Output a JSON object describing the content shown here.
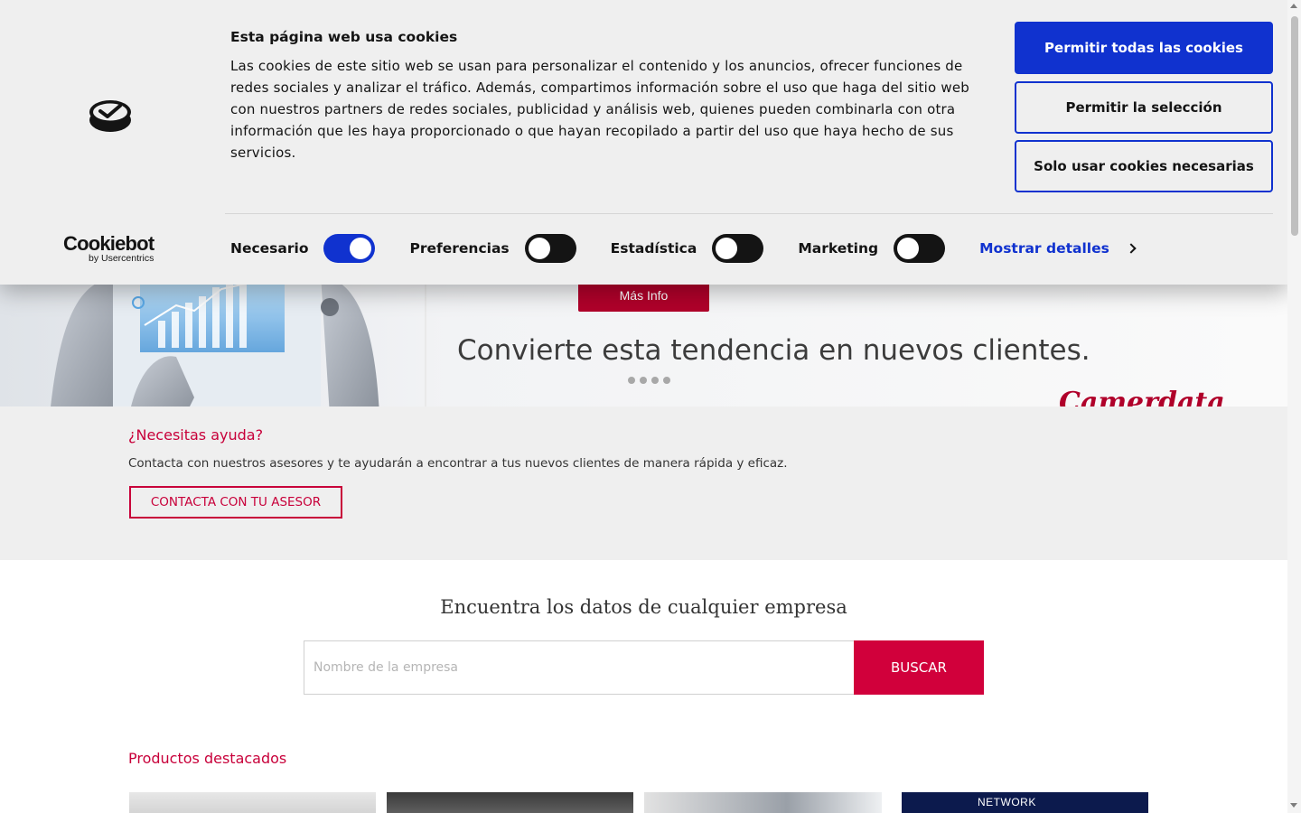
{
  "cookie_banner": {
    "title": "Esta página web usa cookies",
    "text": "Las cookies de este sitio web se usan para personalizar el contenido y los anuncios, ofrecer funciones de redes sociales y analizar el tráfico. Además, compartimos información sobre el uso que haga del sitio web con nuestros partners de redes sociales, publicidad y análisis web, quienes pueden combinarla con otra información que les haya proporcionado o que hayan recopilado a partir del uso que haya hecho de sus servicios.",
    "buttons": {
      "allow_all": "Permitir todas las cookies",
      "allow_selection": "Permitir la selección",
      "necessary_only": "Solo usar cookies necesarias"
    },
    "brand": {
      "name": "Cookiebot",
      "sub": "by Usercentrics"
    },
    "toggles": [
      {
        "label": "Necesario",
        "on": true
      },
      {
        "label": "Preferencias",
        "on": false
      },
      {
        "label": "Estadística",
        "on": false
      },
      {
        "label": "Marketing",
        "on": false
      }
    ],
    "details_link": "Mostrar detalles",
    "accent_color": "#1032cf",
    "icons": [
      "cookiebot-logo-icon",
      "chevron-right-icon"
    ]
  },
  "hero": {
    "button": "Más Info",
    "headline": "Convierte esta tendencia en nuevos clientes.",
    "brand_peek": "Camerdata",
    "slide_count": 4
  },
  "help": {
    "title": "¿Necesitas ayuda?",
    "text": "Contacta con nuestros asesores y te ayudarán a encontrar a tus nuevos clientes de manera rápida y eficaz.",
    "button": "CONTACTA CON TU ASESOR"
  },
  "search": {
    "title": "Encuentra los datos de cualquier empresa",
    "placeholder": "Nombre de la empresa",
    "button": "BUSCAR"
  },
  "products": {
    "title": "Productos destacados",
    "thumb4_text": "NETWORK"
  },
  "colors": {
    "brand_red": "#c8003a",
    "button_red": "#d1003b",
    "cookie_blue": "#1032cf"
  }
}
